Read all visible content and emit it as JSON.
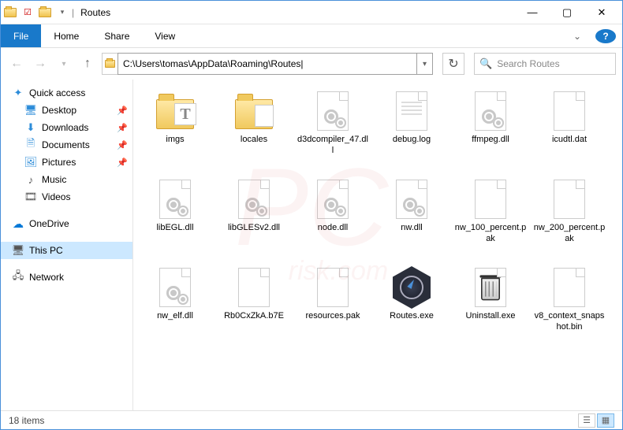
{
  "window": {
    "title": "Routes"
  },
  "tabs": {
    "file": "File",
    "home": "Home",
    "share": "Share",
    "view": "View"
  },
  "nav": {
    "address": "C:\\Users\\tomas\\AppData\\Roaming\\Routes|",
    "search_placeholder": "Search Routes"
  },
  "sidebar": {
    "quick_access": "Quick access",
    "desktop": "Desktop",
    "downloads": "Downloads",
    "documents": "Documents",
    "pictures": "Pictures",
    "music": "Music",
    "videos": "Videos",
    "onedrive": "OneDrive",
    "thispc": "This PC",
    "network": "Network"
  },
  "files": [
    {
      "name": "imgs",
      "type": "folder-imgs"
    },
    {
      "name": "locales",
      "type": "folder-locales"
    },
    {
      "name": "d3dcompiler_47.dll",
      "type": "dll"
    },
    {
      "name": "debug.log",
      "type": "log"
    },
    {
      "name": "ffmpeg.dll",
      "type": "dll"
    },
    {
      "name": "icudtl.dat",
      "type": "file"
    },
    {
      "name": "libEGL.dll",
      "type": "dll"
    },
    {
      "name": "libGLESv2.dll",
      "type": "dll"
    },
    {
      "name": "node.dll",
      "type": "dll"
    },
    {
      "name": "nw.dll",
      "type": "dll"
    },
    {
      "name": "nw_100_percent.pak",
      "type": "file"
    },
    {
      "name": "nw_200_percent.pak",
      "type": "file"
    },
    {
      "name": "nw_elf.dll",
      "type": "dll"
    },
    {
      "name": "Rb0CxZkA.b7E",
      "type": "file"
    },
    {
      "name": "resources.pak",
      "type": "file"
    },
    {
      "name": "Routes.exe",
      "type": "routes-exe"
    },
    {
      "name": "Uninstall.exe",
      "type": "uninstall-exe"
    },
    {
      "name": "v8_context_snapshot.bin",
      "type": "file"
    }
  ],
  "status": {
    "count": "18 items"
  },
  "watermark": {
    "main": "PC",
    "sub": "risk.com"
  }
}
